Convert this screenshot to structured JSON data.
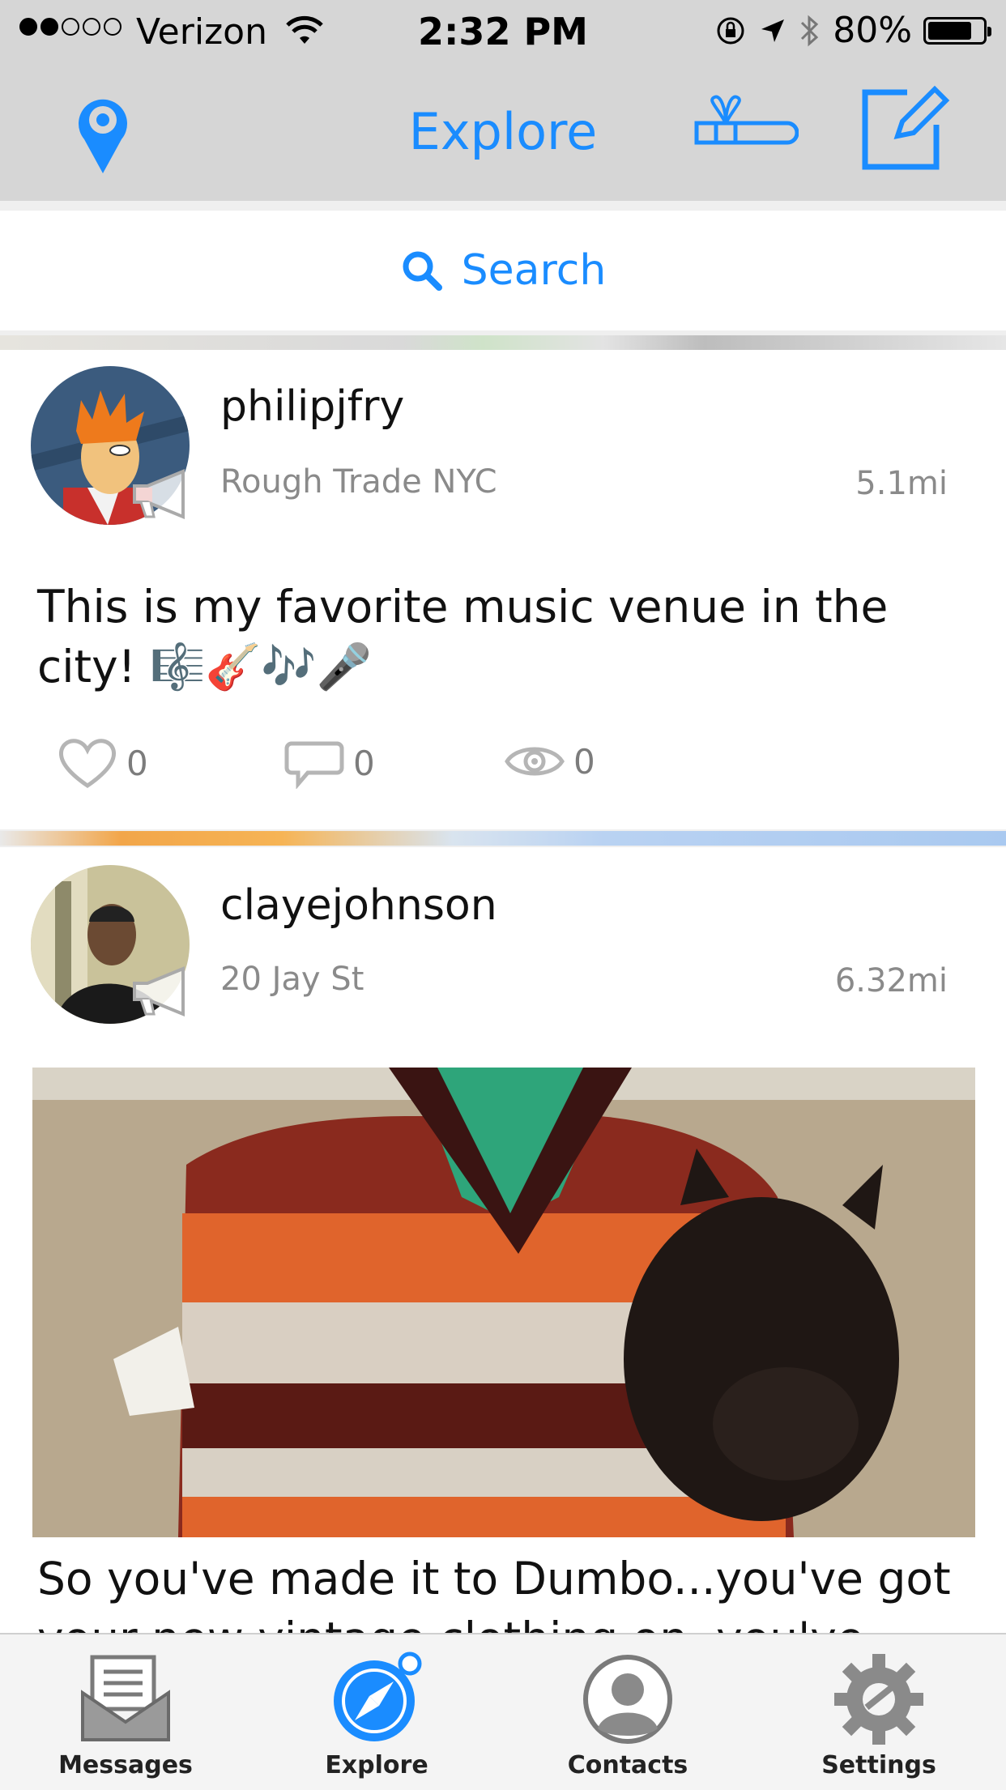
{
  "status": {
    "signal_dots_full": 2,
    "signal_dots_total": 5,
    "carrier": "Verizon",
    "time": "2:32 PM",
    "battery": "80%",
    "battery_level": 0.8
  },
  "nav": {
    "title": "Explore"
  },
  "search": {
    "placeholder": "Search"
  },
  "posts": [
    {
      "username": "philipjfry",
      "location": "Rough Trade NYC",
      "distance": "5.1mi",
      "text": "This is my favorite music venue in the city! 🎼🎸🎶🎤",
      "likes": "0",
      "comments": "0",
      "views": "0"
    },
    {
      "username": "clayejohnson",
      "location": "20 Jay St",
      "distance": "6.32mi",
      "text": "So you've made it to Dumbo...you've got your new vintage clothing on, you've"
    }
  ],
  "tabs": [
    {
      "label": "Messages",
      "icon": "messages-icon"
    },
    {
      "label": "Explore",
      "icon": "compass-icon"
    },
    {
      "label": "Contacts",
      "icon": "contacts-icon"
    },
    {
      "label": "Settings",
      "icon": "gear-icon"
    }
  ],
  "colors": {
    "accent": "#1a8cff",
    "bar": "#d6d6d6",
    "muted": "#8a8a8a"
  }
}
